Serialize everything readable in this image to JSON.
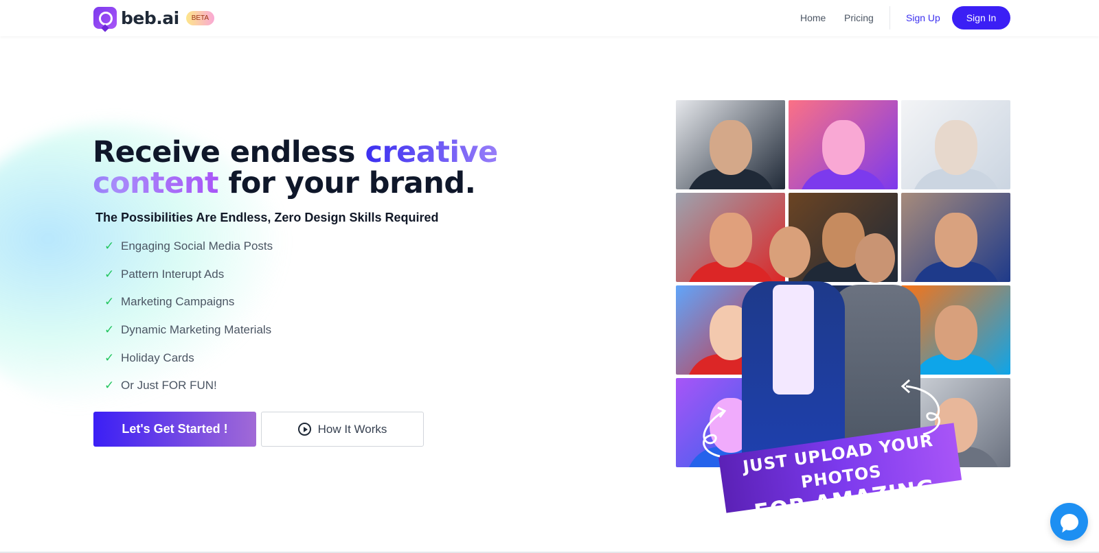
{
  "nav": {
    "brand": "beb.ai",
    "badge": "BETA",
    "links": [
      "Home",
      "Pricing"
    ],
    "sign_up": "Sign Up",
    "sign_in": "Sign In"
  },
  "hero": {
    "headline_pre": "Receive endless ",
    "headline_highlight": "creative content",
    "headline_post": " for your brand.",
    "subheadline": "The Possibilities Are Endless, Zero Design Skills Required",
    "features": [
      "Engaging Social Media Posts",
      "Pattern Interupt Ads",
      "Marketing Campaigns",
      "Dynamic Marketing Materials",
      "Holiday Cards",
      "Or Just FOR FUN!"
    ],
    "check_glyph": "✓",
    "cta_primary": "Let's Get Started !",
    "cta_secondary": "How It Works"
  },
  "gallery": {
    "banner_line1": "JUST UPLOAD YOUR PHOTOS",
    "banner_line2": "FOR AMAZING RESULTS",
    "tile_colors": [
      [
        "#e5e7eb",
        "#d4a889",
        "#1f2937"
      ],
      [
        "#fb7185",
        "#f9a8d4",
        "#7c3aed"
      ],
      [
        "#f3f4f6",
        "#e7d8cc",
        "#cbd5e1"
      ],
      [
        "#9ca3af",
        "#e0a07c",
        "#dc2626"
      ],
      [
        "#6b4423",
        "#c68b5f",
        "#1f2937"
      ],
      [
        "#a78b7b",
        "#d9a27f",
        "#1e3a8a"
      ],
      [
        "#60a5fa",
        "#f3c9ae",
        "#dc2626"
      ],
      [
        "#1e293b",
        "#e0a87f",
        "#1e40af"
      ],
      [
        "#f97316",
        "#d8a07c",
        "#0ea5e9"
      ],
      [
        "#a855f7",
        "#f0abfc",
        "#2563eb"
      ],
      [
        "#1e3a8a",
        "#c68b5f",
        "#374151"
      ],
      [
        "#d1d5db",
        "#e8b79a",
        "#6b7280"
      ]
    ]
  },
  "colors": {
    "brand": "#3b1ff5",
    "accent": "#a855f7",
    "check": "#22c55e",
    "chat": "#1d8ff2"
  },
  "icons": {
    "play": "play-circle-icon",
    "chat": "chat-bubble-icon",
    "logo": "logo-mark-icon"
  }
}
